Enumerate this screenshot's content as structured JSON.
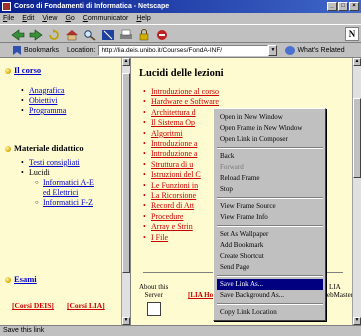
{
  "window": {
    "title": "Corso di Fondamenti di Informatica - Netscape"
  },
  "menubar": [
    "File",
    "Edit",
    "View",
    "Go",
    "Communicator",
    "Help"
  ],
  "location": {
    "bookmarks_label": "Bookmarks",
    "location_label": "Location:",
    "url": "http://lia.deis.unibo.it/Courses/FondA-INF/",
    "related_label": "What's Related"
  },
  "left": {
    "sections": [
      {
        "title": "Il corso",
        "items": [
          "Anagrafica",
          "Obiettivi",
          "Programma"
        ]
      },
      {
        "title": "Materiale didattico",
        "items": [
          "Testi consigliati",
          "Lucidi"
        ],
        "subitems": [
          "Informatici A-E ed Elettrici",
          "Informatici F-Z"
        ]
      },
      {
        "title": "Esami"
      }
    ],
    "footer_links": [
      "[Corsi DEIS]",
      "[Corsi LIA]"
    ]
  },
  "right": {
    "title": "Lucidi delle lezioni",
    "lessons": [
      "Introduzione al corso",
      "Hardware e Software",
      "Architettura d",
      "Il Sistema Op",
      "Algoritmi",
      "Introduzione a",
      "Introduzione a",
      "Struttura di u",
      "Istruzioni del C",
      "Le Funzioni in",
      "La Ricorsione",
      "Record di Att",
      "Procedure",
      "Array e Strin",
      "I File"
    ],
    "bottom_nav": {
      "about": "About this",
      "server": "Server",
      "lia_home": "[LIA Ho",
      "lia_right": "LIA",
      "webmaster": "ebMaster"
    }
  },
  "context_menu": {
    "items": [
      "Open in New Window",
      "Open Frame in New Window",
      "Open Link in Composer",
      "Back",
      "Forward",
      "Reload Frame",
      "Stop",
      "View Frame Source",
      "View Frame Info",
      "Set As Wallpaper",
      "Add Bookmark",
      "Create Shortcut",
      "Send Page",
      "Save Link As...",
      "Save Background As...",
      "Copy Link Location"
    ],
    "disabled": [
      "Forward"
    ],
    "selected": "Save Link As..."
  },
  "status": {
    "text": "Save this link"
  },
  "colors": {
    "page_bg": "#fffbd0",
    "link_red": "#cc0000",
    "link_blue": "#0000cc",
    "titlebar": "#0a1f8f"
  },
  "icons": [
    "back-icon",
    "forward-icon",
    "reload-icon",
    "home-icon",
    "search-icon",
    "netscape-icon",
    "print-icon",
    "security-icon",
    "stop-icon",
    "bookmark-icon"
  ]
}
